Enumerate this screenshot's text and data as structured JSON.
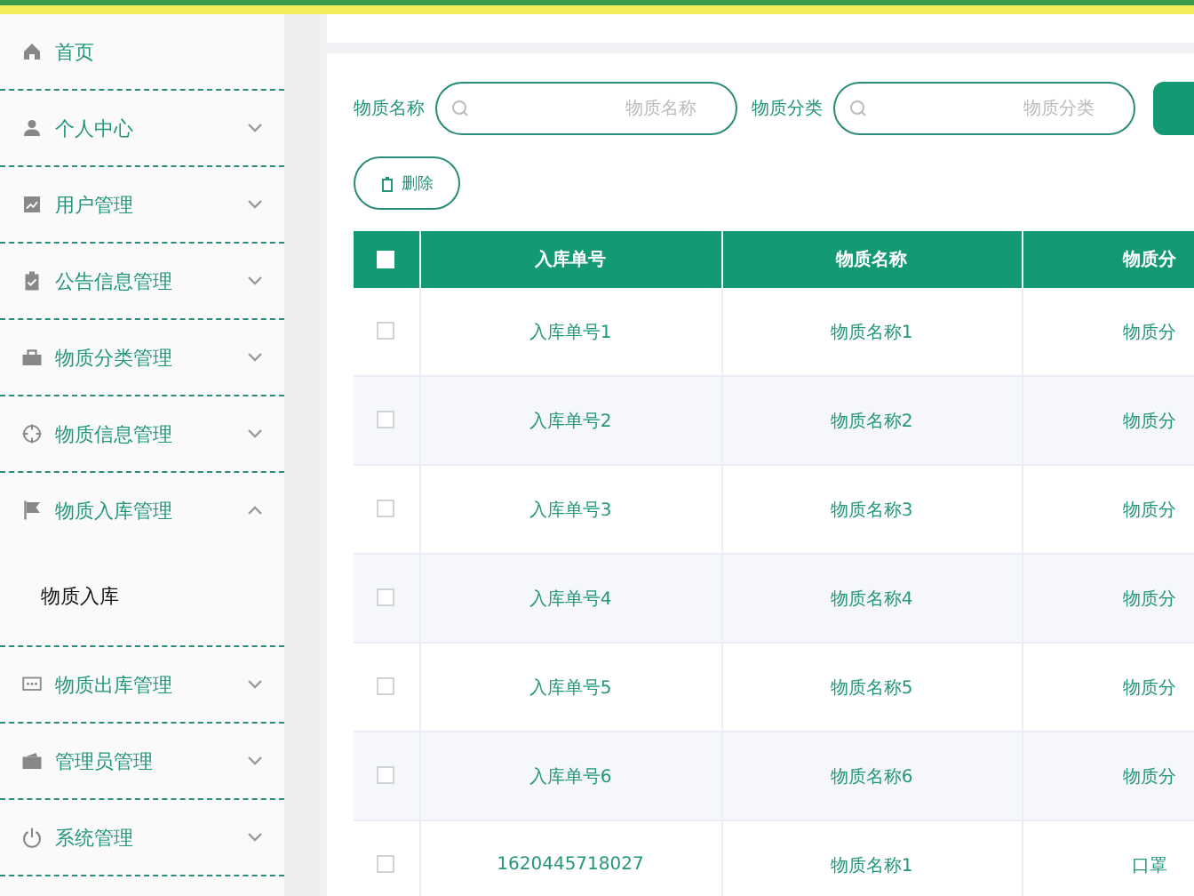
{
  "sidebar": {
    "items": [
      {
        "label": "首页",
        "kind": "link"
      },
      {
        "label": "个人中心",
        "kind": "submenu",
        "expanded": false
      },
      {
        "label": "用户管理",
        "kind": "submenu",
        "expanded": false
      },
      {
        "label": "公告信息管理",
        "kind": "submenu",
        "expanded": false
      },
      {
        "label": "物质分类管理",
        "kind": "submenu",
        "expanded": false
      },
      {
        "label": "物质信息管理",
        "kind": "submenu",
        "expanded": false
      },
      {
        "label": "物质入库管理",
        "kind": "submenu",
        "expanded": true,
        "children": [
          {
            "label": "物质入库"
          }
        ]
      },
      {
        "label": "物质出库管理",
        "kind": "submenu",
        "expanded": false
      },
      {
        "label": "管理员管理",
        "kind": "submenu",
        "expanded": false
      },
      {
        "label": "系统管理",
        "kind": "submenu",
        "expanded": false
      }
    ]
  },
  "search": {
    "fields": [
      {
        "label": "物质名称",
        "placeholder": "物质名称"
      },
      {
        "label": "物质分类",
        "placeholder": "物质分类"
      }
    ]
  },
  "toolbar": {
    "buttons": [
      {
        "label": "删除"
      }
    ]
  },
  "table": {
    "select_all": {
      "checked": false
    },
    "columns": [
      "入库单号",
      "物质名称",
      "物质分"
    ],
    "rows": [
      {
        "checked": false,
        "cells": [
          "入库单号1",
          "物质名称1",
          "物质分"
        ]
      },
      {
        "checked": false,
        "cells": [
          "入库单号2",
          "物质名称2",
          "物质分"
        ]
      },
      {
        "checked": false,
        "cells": [
          "入库单号3",
          "物质名称3",
          "物质分"
        ]
      },
      {
        "checked": false,
        "cells": [
          "入库单号4",
          "物质名称4",
          "物质分"
        ]
      },
      {
        "checked": false,
        "cells": [
          "入库单号5",
          "物质名称5",
          "物质分"
        ]
      },
      {
        "checked": false,
        "cells": [
          "入库单号6",
          "物质名称6",
          "物质分"
        ]
      },
      {
        "checked": false,
        "cells": [
          "1620445718027",
          "物质名称1",
          "口罩"
        ]
      }
    ]
  }
}
